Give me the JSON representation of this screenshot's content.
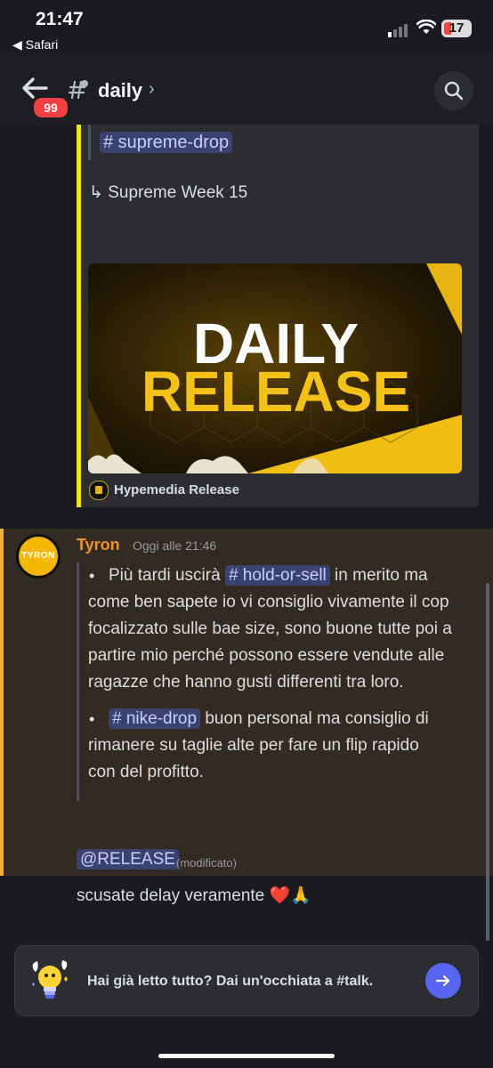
{
  "status_bar": {
    "time": "21:47",
    "back_app": "◀ Safari",
    "battery": "17"
  },
  "header": {
    "unread_count": "99",
    "channel": "daily",
    "chevron": "›"
  },
  "embed": {
    "channel_mention": "# supreme-drop",
    "subtitle": "↳ Supreme Week 15",
    "image_title_line1": "DAILY",
    "image_title_line2": "RELEASE",
    "footer": "Hypemedia Release"
  },
  "message": {
    "author": "Tyron",
    "avatar_text": "TYRON",
    "timestamp": "Oggi alle 21:46",
    "bullet1": {
      "pre": "Più tardi uscirà ",
      "mention": "# hold-or-sell",
      "l1_post": " in merito ma",
      "l2": "come ben sapete io vi consiglio vivamente il cop",
      "l3": "focalizzato sulle bae size, sono buone tutte poi a",
      "l4": "partire mio perché possono essere vendute alle",
      "l5": "ragazze che hanno gusti differenti tra loro."
    },
    "bullet2": {
      "mention": "# nike-drop",
      "l1_post": " buon personal ma consiglio di",
      "l2": "rimanere su taglie alte per fare un flip rapido",
      "l3": "con del profitto."
    },
    "role_mention": "@RELEASE",
    "edited": "(modificato)",
    "followup": "scusate delay veramente ❤️🙏"
  },
  "prompt": {
    "text": "Hai già letto tutto? Dai un'occhiata a #talk."
  },
  "colors": {
    "accent": "#5865f2",
    "highlight": "#332b21",
    "mention_bg": "#3c4270",
    "author": "#f0912d",
    "embed_bar": "#f0e21c"
  }
}
